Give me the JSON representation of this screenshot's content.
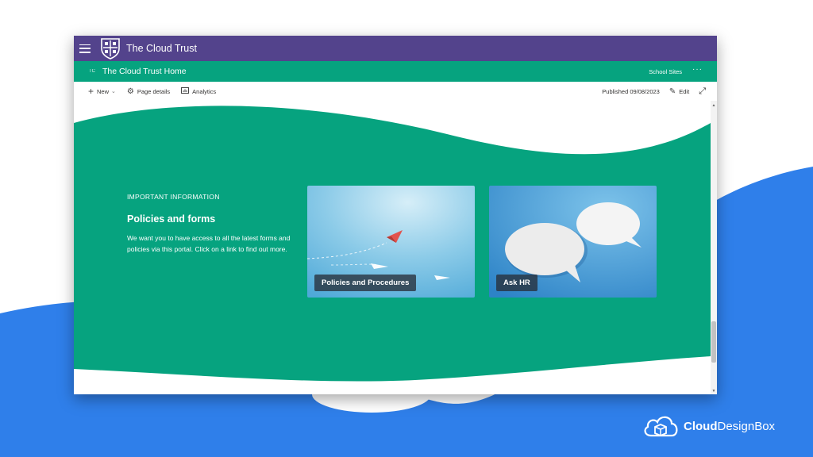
{
  "suite_bar": {
    "site_name": "The Cloud Trust",
    "bg_color": "#53438c",
    "menu_icon": "hamburger-icon",
    "logo_icon": "shield-cross-logo"
  },
  "hub_nav": {
    "badge": "TC",
    "title": "The Cloud Trust Home",
    "school_sites": "School Sites",
    "more": "···",
    "bg_color": "#06a37f"
  },
  "command_bar": {
    "new_label": "New",
    "page_details_label": "Page details",
    "analytics_label": "Analytics",
    "published_label": "Published 09/08/2023",
    "edit_label": "Edit",
    "icons": [
      "plus-icon",
      "gear-icon",
      "analytics-icon",
      "pencil-icon",
      "expand-icon"
    ]
  },
  "hero": {
    "section_label": "IMPORTANT INFORMATION",
    "title": "Policies and forms",
    "description": "We want you to have access to all the latest forms and policies via this portal. Click on a link to find out more.",
    "bg_color": "#06a37f",
    "tiles": [
      {
        "label": "Policies and Procedures",
        "image": "paper-planes-image"
      },
      {
        "label": "Ask HR",
        "image": "speech-bubbles-image"
      }
    ]
  },
  "brand": {
    "name_bold": "Cloud",
    "name_regular": "DesignBox",
    "accent_color": "#2f7fea",
    "logo_icon": "cloud-box-icon"
  }
}
